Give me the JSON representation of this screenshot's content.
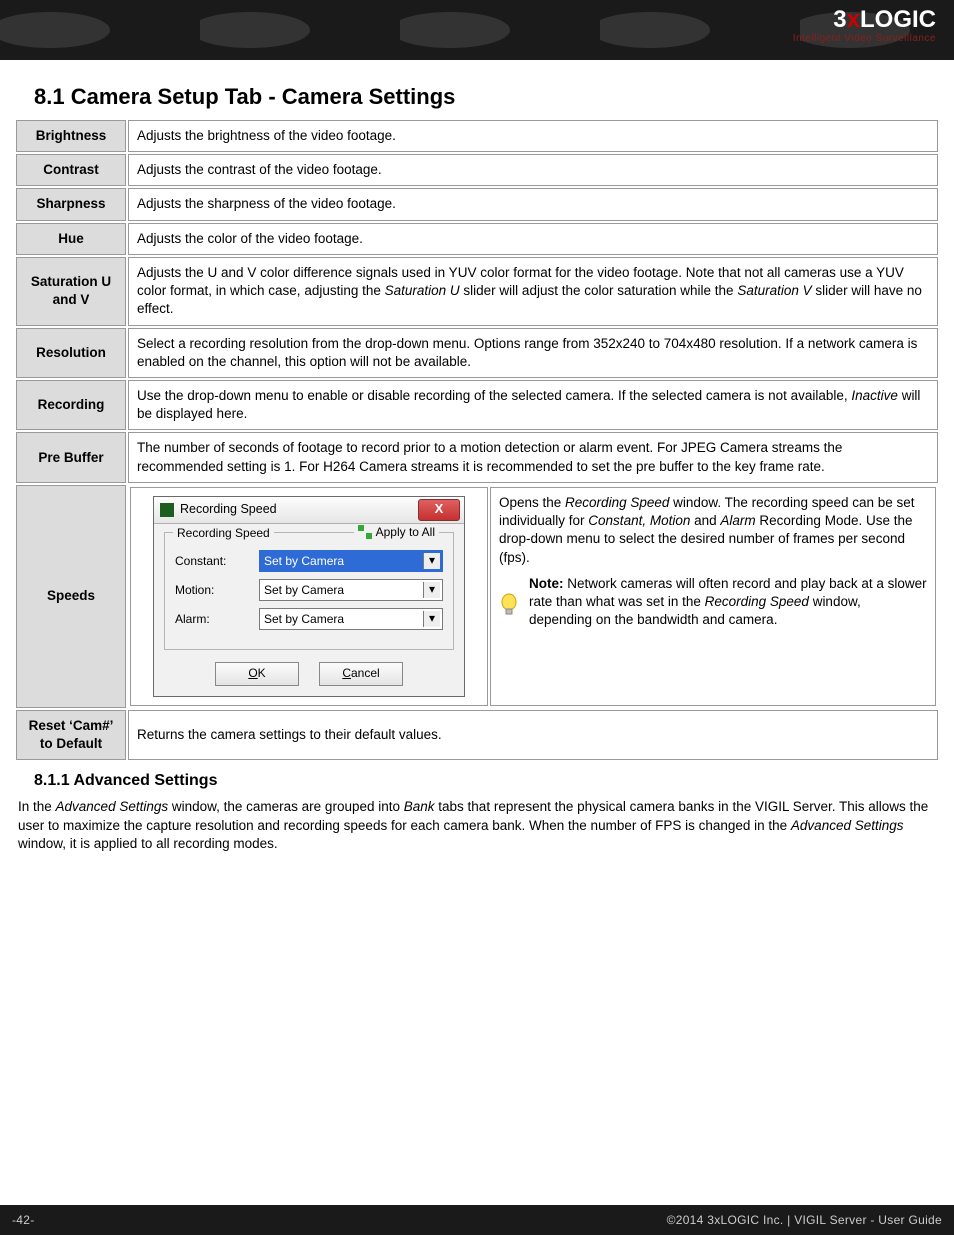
{
  "header": {
    "brand_main": "3",
    "brand_x": "x",
    "brand_rest": "LOGIC",
    "brand_tag": "Intelligent Video Surveillance"
  },
  "section": {
    "title": "8.1 Camera Setup Tab - Camera Settings"
  },
  "rows": {
    "brightness": {
      "label": "Brightness",
      "desc": "Adjusts the brightness of the video footage."
    },
    "contrast": {
      "label": "Contrast",
      "desc": "Adjusts the contrast of the video footage."
    },
    "sharpness": {
      "label": "Sharpness",
      "desc": "Adjusts the sharpness of the video footage."
    },
    "hue": {
      "label": "Hue",
      "desc": "Adjusts the color of the video footage."
    },
    "saturation": {
      "label": "Saturation U and V",
      "desc_a": "Adjusts the U and V color difference signals used in YUV color format for the video footage.  Note that not all cameras use a YUV color format, in which case, adjusting the ",
      "desc_em1": "Saturation U",
      "desc_b": " slider will adjust the color saturation while the ",
      "desc_em2": "Saturation V",
      "desc_c": " slider will have no effect."
    },
    "resolution": {
      "label": "Resolution",
      "desc": "Select a recording resolution from the drop-down menu. Options range from 352x240 to 704x480 resolution. If a network camera is enabled on the channel, this option will not be available."
    },
    "recording": {
      "label": "Recording",
      "desc_a": "Use the drop-down menu to enable or disable recording of the selected camera. If the selected camera is not available, ",
      "desc_em": "Inactive",
      "desc_b": " will be displayed here."
    },
    "prebuffer": {
      "label": "Pre Buffer",
      "desc": "The number of seconds of footage to record prior to a motion detection or alarm event.  For JPEG Camera streams the recommended setting is 1.  For H264 Camera streams it is recommended to set the pre buffer to the key frame rate."
    },
    "speeds": {
      "label": "Speeds",
      "dialog": {
        "title": "Recording Speed",
        "fieldset_legend": "Recording Speed",
        "apply_all": "Apply to All",
        "constant_label": "Constant:",
        "motion_label": "Motion:",
        "alarm_label": "Alarm:",
        "combo_value": "Set by Camera",
        "ok": "OK",
        "cancel": "Cancel",
        "close_x": "X"
      },
      "desc_a": "Opens the ",
      "desc_em1": "Recording Speed",
      "desc_b": " window. The recording speed can be set individually for ",
      "desc_em2": "Constant, Motion",
      "desc_c": " and ",
      "desc_em3": "Alarm",
      "desc_d": " Recording Mode. Use the drop-down menu to select the desired number of frames per second (fps).",
      "note_label": "Note:",
      "note_a": " Network cameras will often record and play back at a slower rate than what was set in the ",
      "note_em": "Recording Speed",
      "note_b": " window, depending on the bandwidth and camera."
    },
    "reset": {
      "label": "Reset ‘Cam#’ to Default",
      "desc": "Returns the camera settings to their default values."
    }
  },
  "subsection": {
    "title": "8.1.1 Advanced Settings",
    "body_a": "In the ",
    "body_em1": "Advanced Settings",
    "body_b": " window, the cameras are grouped into ",
    "body_em2": "Bank",
    "body_c": " tabs that represent the physical camera banks in the VIGIL Server. This allows the user to maximize the capture resolution and recording speeds for each camera bank. When the number of FPS is changed in the ",
    "body_em3": "Advanced Settings",
    "body_d": " window, it is applied to all recording modes."
  },
  "footer": {
    "page_no": "-42-",
    "right": "©2014 3xLOGIC Inc. | VIGIL Server - User Guide"
  }
}
